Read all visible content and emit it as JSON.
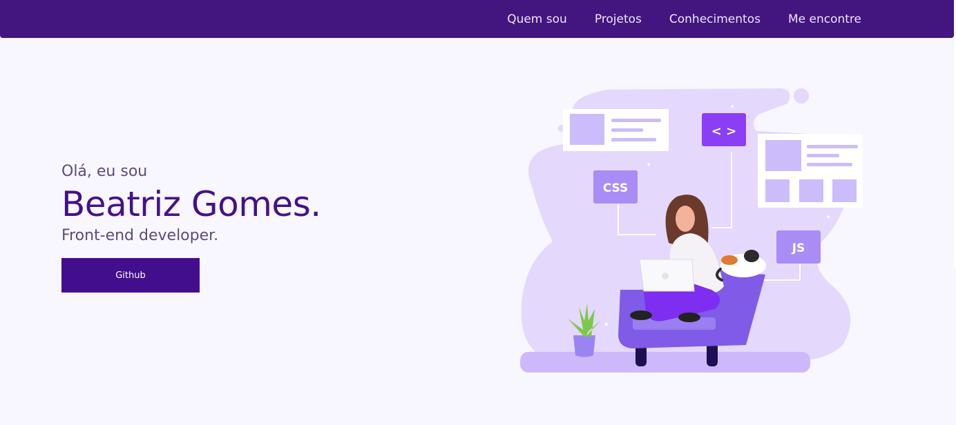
{
  "nav": {
    "items": [
      {
        "label": "Quem sou"
      },
      {
        "label": "Projetos"
      },
      {
        "label": "Conhecimentos"
      },
      {
        "label": "Me encontre"
      }
    ]
  },
  "hero": {
    "greeting": "Olá, eu sou",
    "name": "Beatriz Gomes.",
    "role": "Front-end developer.",
    "button_label": "Github"
  },
  "illustration": {
    "css_tag": "CSS",
    "js_tag": "JS",
    "code_tag": "< >"
  },
  "colors": {
    "navbar": "#43157e",
    "accent": "#430e8e",
    "background": "#f8f6fe",
    "illustration_light": "#e4d8fc",
    "illustration_mid": "#a98cf5",
    "illustration_dark": "#8a3ff5"
  }
}
